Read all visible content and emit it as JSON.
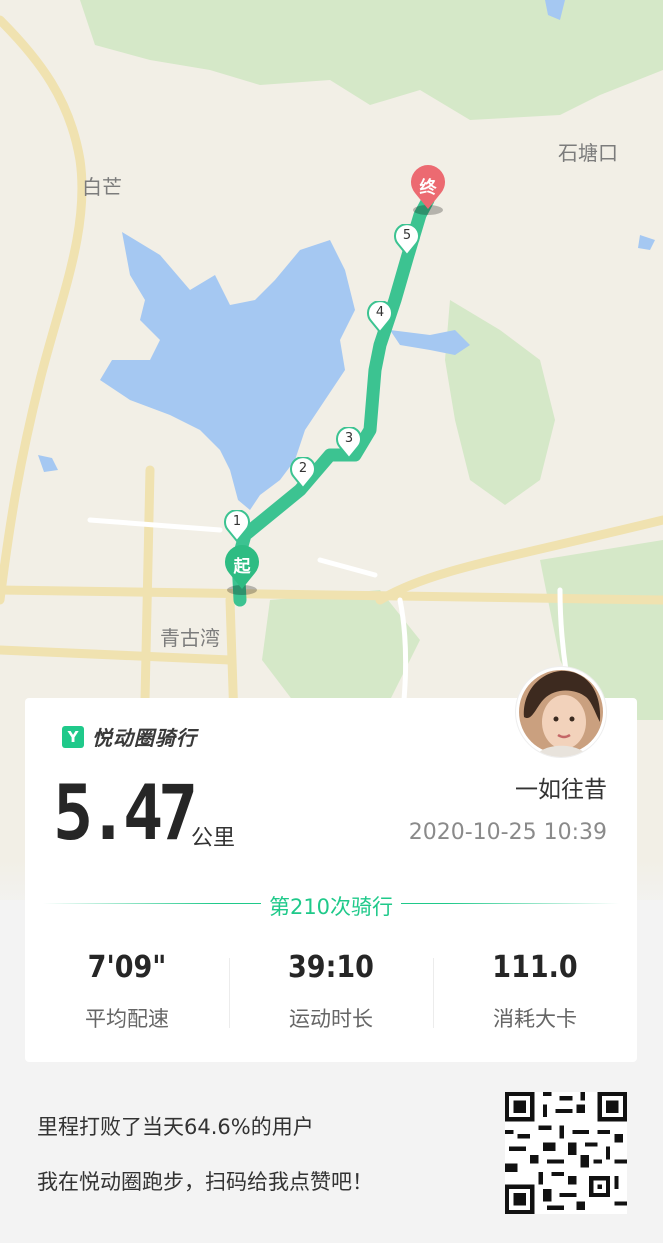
{
  "map": {
    "place_names": {
      "baimang": "白芒",
      "shitangkou": "石塘口",
      "qinggu_wan": "青古湾"
    },
    "start_label": "起",
    "end_label": "终",
    "km_markers": [
      "1",
      "2",
      "3",
      "4",
      "5"
    ],
    "route_color": "#3cc391",
    "end_pin_color": "#ec6a71"
  },
  "card": {
    "brand_icon_glyph": "Y",
    "brand_name": "悦动圈骑行",
    "distance_value": "5.47",
    "distance_unit": "公里",
    "username": "一如往昔",
    "datetime": "2020-10-25 10:39",
    "ride_count": "第210次骑行",
    "stats": [
      {
        "value": "7'09\"",
        "label": "平均配速"
      },
      {
        "value": "39:10",
        "label": "运动时长"
      },
      {
        "value": "111.0",
        "label": "消耗大卡"
      }
    ]
  },
  "footer": {
    "line1": "里程打败了当天64.6%的用户",
    "line2": "我在悦动圈跑步，扫码给我点赞吧！"
  },
  "colors": {
    "accent": "#1fc98a"
  }
}
